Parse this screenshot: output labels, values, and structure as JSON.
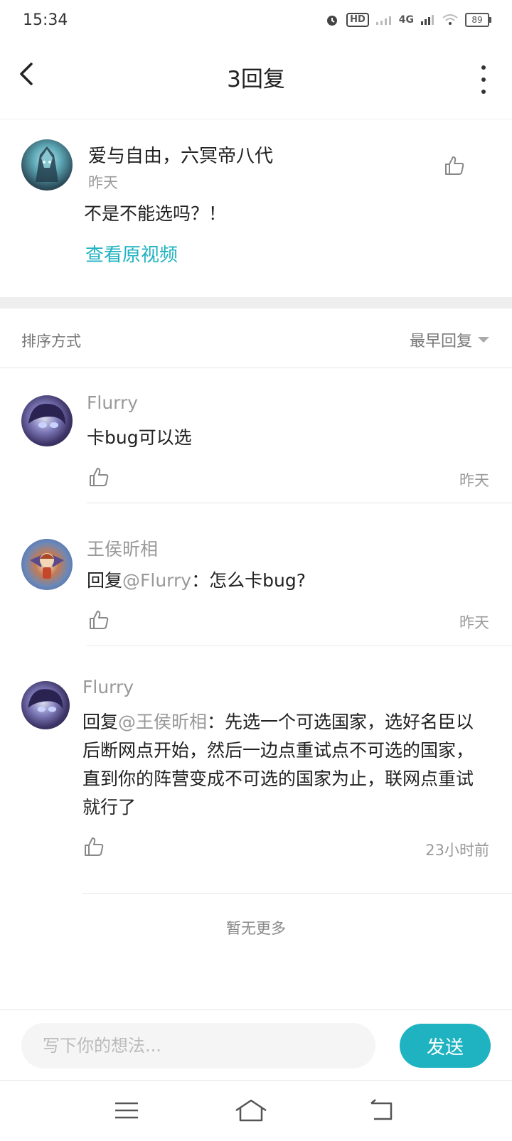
{
  "status_bar": {
    "time": "15:34",
    "hd_label": "HD",
    "network_label": "4G",
    "battery": "89"
  },
  "header": {
    "title": "3回复"
  },
  "main_comment": {
    "author": "爱与自由，六冥帝八代",
    "time": "昨天",
    "text": "不是不能选吗？！",
    "link": "查看原视频"
  },
  "sort": {
    "label": "排序方式",
    "selected": "最早回复"
  },
  "replies": [
    {
      "name": "Flurry",
      "prefix": "",
      "mention": "",
      "text": "卡bug可以选",
      "time": "昨天"
    },
    {
      "name": "王侯昕相",
      "prefix": "回复",
      "mention": "@Flurry",
      "text": "：怎么卡bug?",
      "time": "昨天"
    },
    {
      "name": "Flurry",
      "prefix": "回复",
      "mention": "@王侯昕相",
      "text": "：先选一个可选国家，选好名臣以后断网点开始，然后一边点重试点不可选的国家，直到你的阵营变成不可选的国家为止，联网点重试就行了",
      "time": "23小时前"
    }
  ],
  "footer": {
    "no_more": "暂无更多"
  },
  "composer": {
    "placeholder": "写下你的想法...",
    "send_label": "发送"
  },
  "colors": {
    "accent": "#1fb3c1",
    "secondary_text": "#999999",
    "divider": "#eeeeee"
  },
  "icons": {
    "back": "back-arrow-icon",
    "more": "more-vertical-icon",
    "like": "thumbs-up-icon",
    "nav_menu": "menu-icon",
    "nav_home": "home-icon",
    "nav_back": "return-icon"
  }
}
